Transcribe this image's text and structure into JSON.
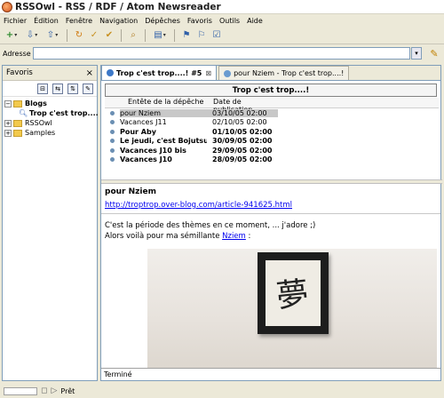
{
  "window": {
    "title": "RSSOwl - RSS / RDF / Atom Newsreader"
  },
  "menu": [
    "Fichier",
    "Édition",
    "Fenêtre",
    "Navigation",
    "Dépêches",
    "Favoris",
    "Outils",
    "Aide"
  ],
  "toolbar": {
    "icons": [
      "new-icon",
      "import-icon",
      "export-icon",
      "reload-icon",
      "mark-read-icon",
      "mark-all-icon",
      "search-icon",
      "layout-icon",
      "favorite-add-icon",
      "favorite-add2-icon",
      "checkbox-icon"
    ]
  },
  "address": {
    "label": "Adresse",
    "value": ""
  },
  "sidebar": {
    "title": "Favoris",
    "tree": [
      {
        "label": "Blogs",
        "expanded": true,
        "bold": true,
        "children": [
          {
            "label": "Trop c'est trop....",
            "bold": true
          }
        ]
      },
      {
        "label": "RSSOwl",
        "expanded": false
      },
      {
        "label": "Samples",
        "expanded": false
      }
    ]
  },
  "tabs": [
    {
      "label": "Trop c'est trop....! #5",
      "active": true
    },
    {
      "label": "pour Nziem - Trop c'est trop....!",
      "active": false
    }
  ],
  "feed": {
    "title": "Trop c'est trop....!"
  },
  "news_table": {
    "headers": [
      "Entête de la dépêche",
      "Date de publication"
    ],
    "rows": [
      {
        "title": "pour Nziem",
        "date": "03/10/05 02:00",
        "selected": true,
        "unread": false
      },
      {
        "title": "Vacances J11",
        "date": "02/10/05 02:00",
        "selected": false,
        "unread": false
      },
      {
        "title": "Pour Aby",
        "date": "01/10/05 02:00",
        "selected": false,
        "unread": true
      },
      {
        "title": "Le jeudi, c'est Bojutsu",
        "date": "30/09/05 02:00",
        "selected": false,
        "unread": true
      },
      {
        "title": "Vacances J10 bis",
        "date": "29/09/05 02:00",
        "selected": false,
        "unread": true
      },
      {
        "title": "Vacances J10",
        "date": "28/09/05 02:00",
        "selected": false,
        "unread": true
      }
    ]
  },
  "article": {
    "title": "pour Nziem",
    "link": "http://troptrop.over-blog.com/article-941625.html",
    "line1": "C'est la période des thèmes en ce moment, ... j'adore ;)",
    "line2_prefix": "Alors voilà pour ma sémillante",
    "line2_link": "Nziem",
    "line2_suffix": " :",
    "calligraphy": "夢"
  },
  "browser_status": "Terminé",
  "status": "Prêt"
}
